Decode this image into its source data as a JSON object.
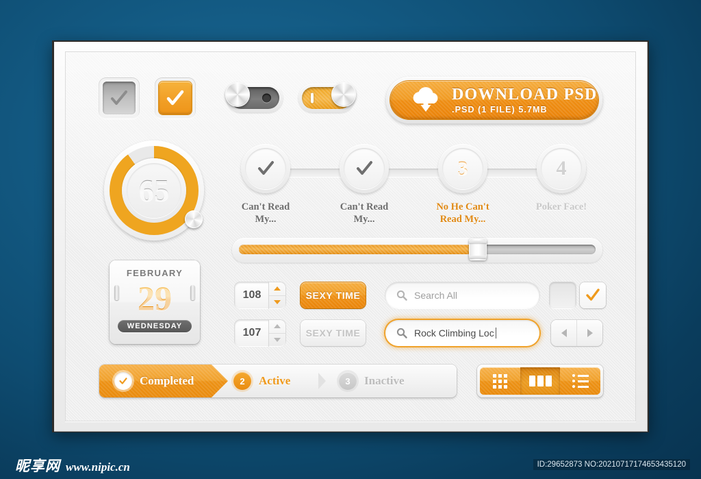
{
  "background": {
    "color": "#0e4c71"
  },
  "accent": {
    "orange": "#ef9a1d",
    "orange_dark": "#e98a0c",
    "gray": "#bdbdbd"
  },
  "checkboxes_top": [
    {
      "name": "checkbox-gray",
      "state": "checked-disabled",
      "icon": "check-icon"
    },
    {
      "name": "checkbox-orange",
      "state": "checked",
      "icon": "check-icon"
    }
  ],
  "toggles": [
    {
      "name": "toggle-off",
      "state": "off",
      "glyph": "power-off-icon"
    },
    {
      "name": "toggle-on",
      "state": "on",
      "glyph": "power-on-icon"
    }
  ],
  "download_button": {
    "icon": "cloud-download-icon",
    "title": "DOWNLOAD PSD",
    "subtitle": ".PSD (1 FILE) 5.7MB"
  },
  "dial": {
    "value": "65",
    "percent": 90,
    "knob": "dial-handle"
  },
  "steps": [
    {
      "badge": "check",
      "label": "Can't Read\nMy...",
      "state": "done"
    },
    {
      "badge": "check",
      "label": "Can't Read\nMy...",
      "state": "done"
    },
    {
      "badge": "3",
      "label": "No He Can't\nRead My...",
      "state": "active"
    },
    {
      "badge": "4",
      "label": "Poker Face!",
      "state": "inactive"
    }
  ],
  "step_labels": [
    {
      "line1": "Can't Read",
      "line2": "My..."
    },
    {
      "line1": "Can't Read",
      "line2": "My..."
    },
    {
      "line1": "No He Can't",
      "line2": "Read My..."
    },
    {
      "line1": "Poker Face!",
      "line2": ""
    }
  ],
  "slider": {
    "name": "progress-slider",
    "percent": 67
  },
  "calendar": {
    "month": "FEBRUARY",
    "day": "29",
    "weekday": "WEDNESDAY"
  },
  "form_rows": [
    {
      "stepper_value": "108",
      "stepper_state": "up-active",
      "button_label": "SEXY TIME",
      "button_state": "active",
      "search_value": "",
      "search_placeholder": "Search All",
      "search_state": "idle"
    },
    {
      "stepper_value": "107",
      "stepper_state": "idle",
      "button_label": "SEXY TIME",
      "button_state": "disabled",
      "search_value": "Rock Climbing Loc",
      "search_placeholder": "",
      "search_state": "focused"
    }
  ],
  "square_checks": [
    {
      "name": "checkbox-unchecked",
      "state": "unchecked"
    },
    {
      "name": "checkbox-checked",
      "state": "checked"
    }
  ],
  "pager": {
    "prev": "prev-arrow-icon",
    "next": "next-arrow-icon"
  },
  "breadcrumb": [
    {
      "badge": "check",
      "label": "Completed",
      "state": "completed"
    },
    {
      "badge": "2",
      "label": "Active",
      "state": "active"
    },
    {
      "badge": "3",
      "label": "Inactive",
      "state": "inactive"
    }
  ],
  "view_toggle": [
    {
      "name": "view-grid",
      "icon": "grid-view-icon",
      "state": "idle"
    },
    {
      "name": "view-columns",
      "icon": "column-view-icon",
      "state": "active"
    },
    {
      "name": "view-list",
      "icon": "list-view-icon",
      "state": "idle"
    }
  ],
  "footer": {
    "logo_cn": "昵享网",
    "logo_url": "www.nipic.cn",
    "id_text": "ID:29652873 NO:20210717174653435120"
  }
}
